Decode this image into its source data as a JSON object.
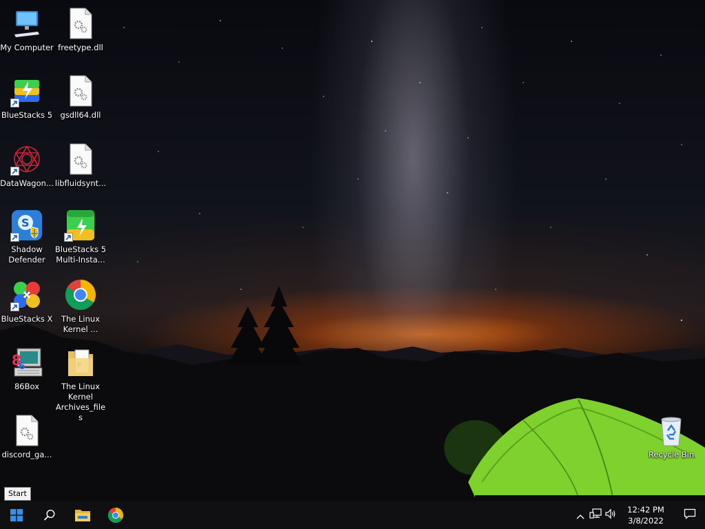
{
  "desktop": {
    "icons": [
      {
        "label": "My Computer",
        "icon": "computer-icon"
      },
      {
        "label": "freetype.dll",
        "icon": "dll-file-icon"
      },
      {
        "label": "BlueStacks 5",
        "icon": "bluestacks-icon"
      },
      {
        "label": "gsdll64.dll",
        "icon": "dll-file-icon"
      },
      {
        "label": "DataWagon...",
        "icon": "datawagon-icon"
      },
      {
        "label": "libfluidsynt...",
        "icon": "dll-file-icon"
      },
      {
        "label": "Shadow Defender",
        "icon": "shadow-defender-icon"
      },
      {
        "label": "BlueStacks 5 Multi-Insta...",
        "icon": "bluestacks-multi-instance-icon"
      },
      {
        "label": "BlueStacks X",
        "icon": "bluestacks-x-icon"
      },
      {
        "label": "The Linux Kernel ...",
        "icon": "chrome-icon"
      },
      {
        "label": "86Box",
        "icon": "86box-icon"
      },
      {
        "label": "The Linux Kernel Archives_files",
        "icon": "folder-icon"
      },
      {
        "label": "discord_ga...",
        "icon": "dll-file-icon"
      },
      {
        "label": "Recycle Bin",
        "icon": "recycle-bin-icon"
      }
    ]
  },
  "tooltip": {
    "text": "Start"
  },
  "taskbar": {
    "start_icon": "windows-logo-icon",
    "search_icon": "search-icon",
    "pinned": [
      "file-explorer-icon",
      "chrome-icon"
    ],
    "tray": {
      "icons": [
        "chevron-up-icon",
        "network-icon",
        "volume-icon"
      ],
      "time": "12:42 PM",
      "date": "3/8/2022",
      "notification_icon": "notification-icon"
    }
  },
  "colors": {
    "taskbar_bg": "#101012",
    "windows_blue": "#3a8ee6",
    "tent_green": "#8ee03a",
    "horizon_orange": "#e66e14"
  }
}
